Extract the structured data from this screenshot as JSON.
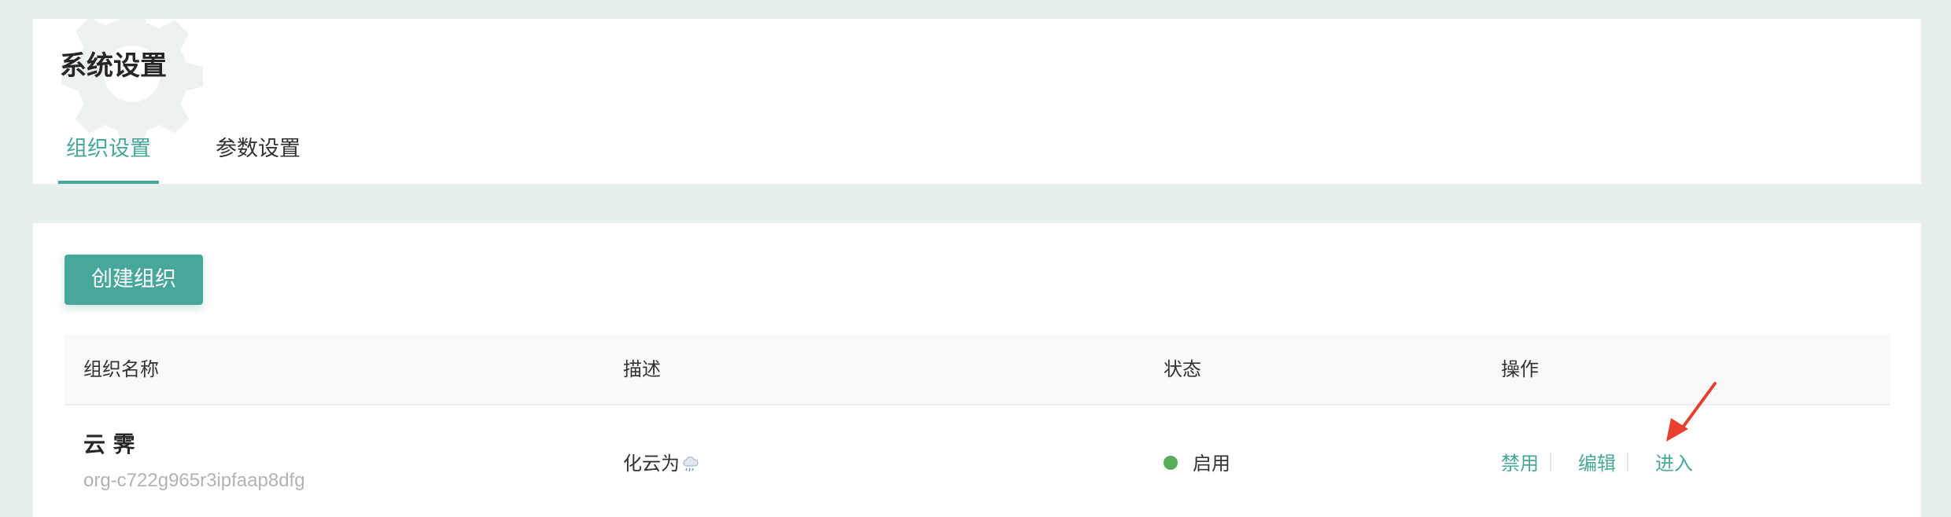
{
  "header": {
    "title": "系统设置"
  },
  "tabs": [
    {
      "label": "组织设置",
      "active": true
    },
    {
      "label": "参数设置",
      "active": false
    }
  ],
  "toolbar": {
    "create_label": "创建组织"
  },
  "table": {
    "columns": [
      "组织名称",
      "描述",
      "状态",
      "操作"
    ],
    "rows": [
      {
        "name": "云 霁",
        "id": "org-c722g965r3ipfaap8dfg",
        "description": "化云为",
        "description_icon": "rain-cloud-icon",
        "status": "启用",
        "actions": [
          "禁用",
          "编辑",
          "进入"
        ]
      }
    ]
  },
  "colors": {
    "accent": "#48a79b",
    "status_enabled": "#5aae57",
    "annotation_arrow": "#e8402e",
    "page_background": "#e8f0ef"
  }
}
